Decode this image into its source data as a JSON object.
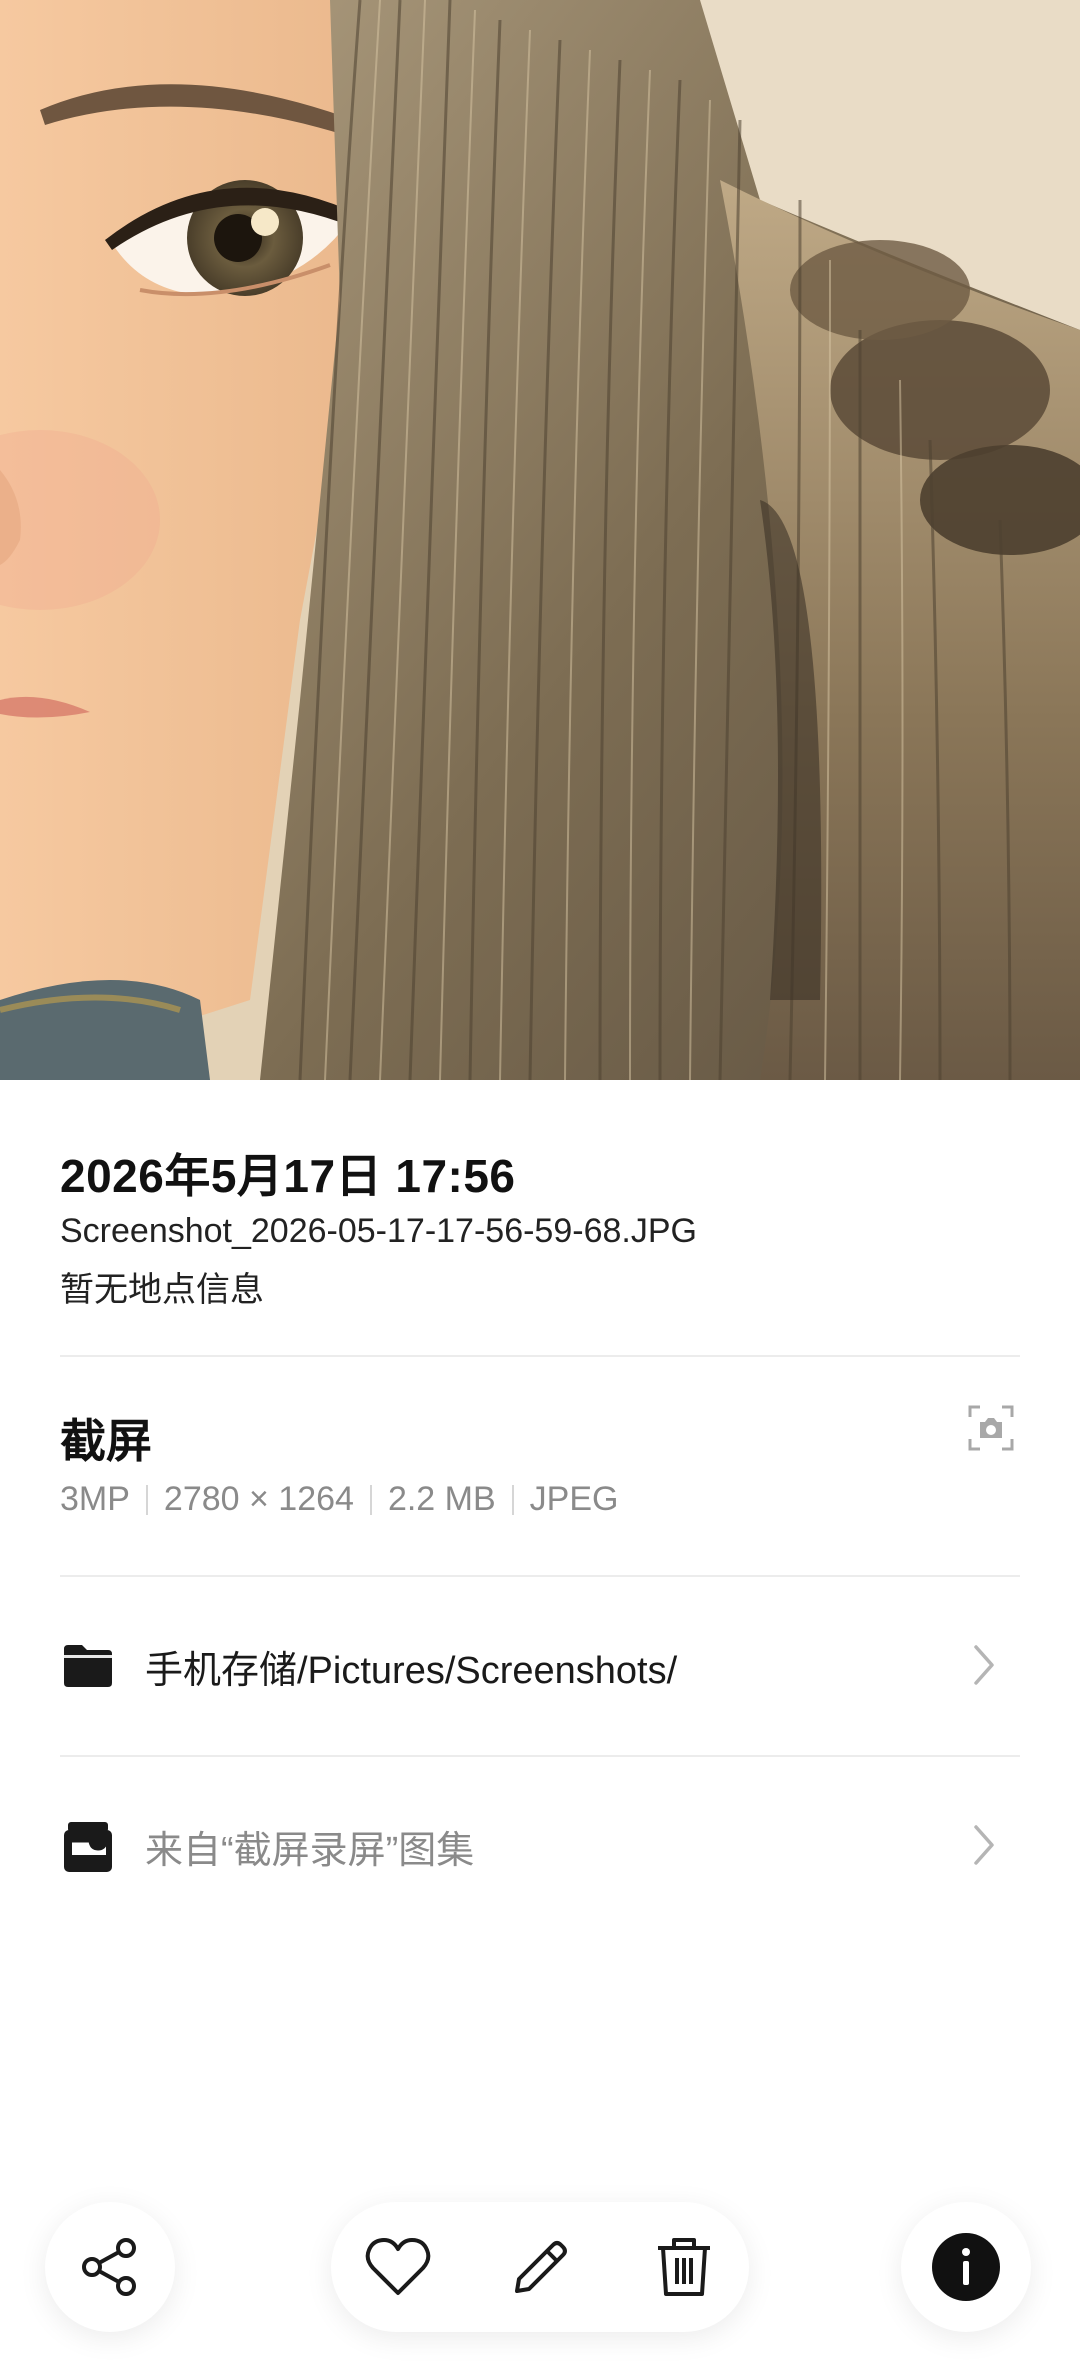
{
  "photo": {
    "description_icon": "photo-preview"
  },
  "details": {
    "date_time": "2026年5月17日 17:56",
    "file_name": "Screenshot_2026-05-17-17-56-59-68.JPG",
    "location": "暂无地点信息"
  },
  "source": {
    "type_label": "截屏",
    "icon": "camera-icon",
    "megapixels": "3MP",
    "resolution": "2780 × 1264",
    "file_size": "2.2 MB",
    "format": "JPEG"
  },
  "storage": {
    "icon": "folder-icon",
    "path": "手机存储/Pictures/Screenshots/"
  },
  "album": {
    "icon": "album-icon",
    "label": "来自“截屏录屏”图集"
  },
  "toolbar": {
    "share_icon": "share-icon",
    "favorite_icon": "heart-icon",
    "edit_icon": "pencil-icon",
    "delete_icon": "trash-icon",
    "info_icon": "info-icon"
  },
  "colors": {
    "text_primary": "#111111",
    "text_secondary": "#8a8a8a",
    "divider": "#ececec",
    "info_button": "#111111"
  }
}
